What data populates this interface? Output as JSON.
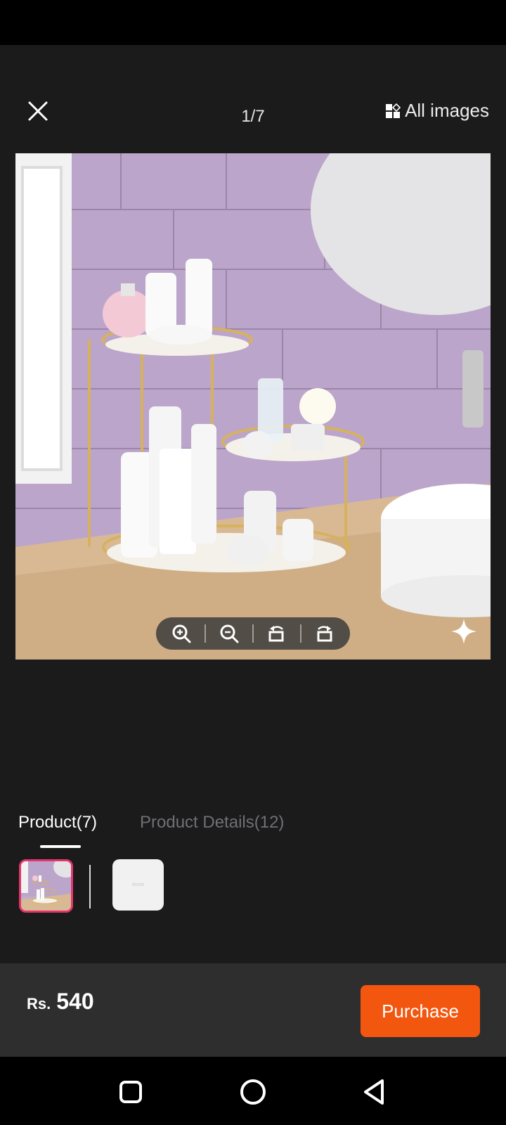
{
  "header": {
    "counter": "1/7",
    "all_images_label": "All images",
    "close_icon": "close-icon",
    "all_images_icon": "grid-icon"
  },
  "viewer": {
    "toolbar_icons": [
      "zoom-in-icon",
      "zoom-out-icon",
      "rotate-left-icon",
      "rotate-right-icon"
    ],
    "sparkle_icon": "sparkle-icon"
  },
  "tabs": [
    {
      "label": "Product(7)",
      "active": true
    },
    {
      "label": "Product Details(12)",
      "active": false
    }
  ],
  "thumbnails": {
    "selected_index": 0,
    "second_thumb_text": "dume"
  },
  "purchase": {
    "currency": "Rs.",
    "price": "540",
    "button_label": "Purchase",
    "accent_color": "#f3560e"
  },
  "nav": {
    "icons": [
      "recents-square-icon",
      "home-circle-icon",
      "back-triangle-icon"
    ]
  }
}
